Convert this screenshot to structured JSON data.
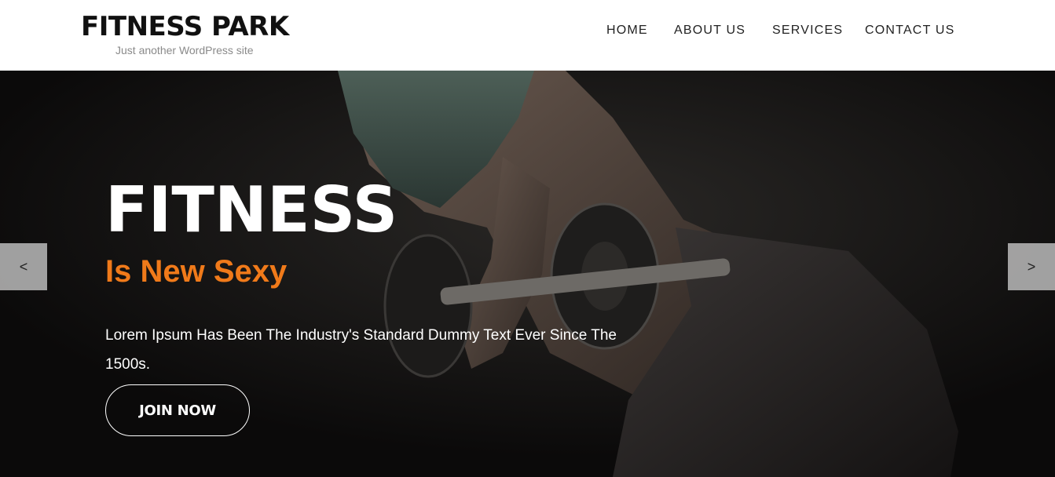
{
  "header": {
    "site_title": "FITNESS PARK",
    "tagline": "Just another WordPress site",
    "nav": [
      {
        "label": "HOME"
      },
      {
        "label": "ABOUT US"
      },
      {
        "label": "SERVICES"
      },
      {
        "label": "CONTACT US"
      }
    ]
  },
  "hero": {
    "title": "FITNESS",
    "subtitle": "Is New Sexy",
    "text": "Lorem Ipsum Has Been The Industry's Standard Dummy Text Ever Since The 1500s.",
    "button_label": "JOIN NOW",
    "prev_arrow": "<",
    "next_arrow": ">",
    "prev_icon": "chevron-left-icon",
    "next_icon": "chevron-right-icon"
  },
  "colors": {
    "accent": "#f07a1a",
    "hero_background": "#0b0a0a",
    "header_background": "#ffffff"
  }
}
